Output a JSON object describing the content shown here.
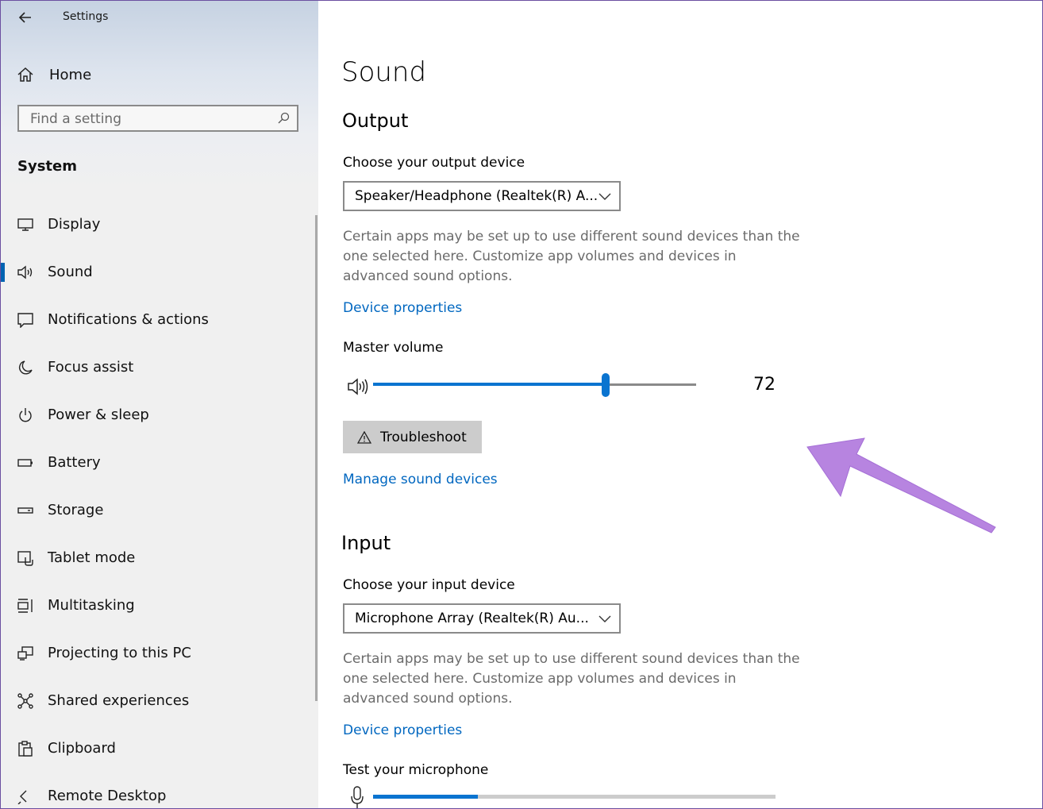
{
  "window": {
    "title": "Settings"
  },
  "sidebar": {
    "home_label": "Home",
    "search_placeholder": "Find a setting",
    "section": "System",
    "items": [
      {
        "label": "Display",
        "icon": "display-icon"
      },
      {
        "label": "Sound",
        "icon": "speaker-icon",
        "active": true
      },
      {
        "label": "Notifications & actions",
        "icon": "notifications-icon"
      },
      {
        "label": "Focus assist",
        "icon": "moon-icon"
      },
      {
        "label": "Power & sleep",
        "icon": "power-icon"
      },
      {
        "label": "Battery",
        "icon": "battery-icon"
      },
      {
        "label": "Storage",
        "icon": "storage-icon"
      },
      {
        "label": "Tablet mode",
        "icon": "tablet-mode-icon"
      },
      {
        "label": "Multitasking",
        "icon": "multitasking-icon"
      },
      {
        "label": "Projecting to this PC",
        "icon": "projecting-icon"
      },
      {
        "label": "Shared experiences",
        "icon": "shared-experiences-icon"
      },
      {
        "label": "Clipboard",
        "icon": "clipboard-icon"
      },
      {
        "label": "Remote Desktop",
        "icon": "remote-desktop-icon"
      }
    ]
  },
  "main": {
    "title": "Sound",
    "output": {
      "heading": "Output",
      "choose_label": "Choose your output device",
      "device": "Speaker/Headphone (Realtek(R) A...",
      "description": "Certain apps may be set up to use different sound devices than the one selected here. Customize app volumes and devices in advanced sound options.",
      "device_properties": "Device properties",
      "master_volume_label": "Master volume",
      "volume": 72,
      "volume_text": "72",
      "troubleshoot": "Troubleshoot",
      "manage_devices": "Manage sound devices"
    },
    "input": {
      "heading": "Input",
      "choose_label": "Choose your input device",
      "device": "Microphone Array (Realtek(R) Au...",
      "description": "Certain apps may be set up to use different sound devices than the one selected here. Customize app volumes and devices in advanced sound options.",
      "device_properties": "Device properties",
      "test_label": "Test your microphone",
      "mic_level": 26
    }
  },
  "colors": {
    "accent": "#0a74d0",
    "link": "#0067c0",
    "annotation_arrow": "#b784e0"
  }
}
